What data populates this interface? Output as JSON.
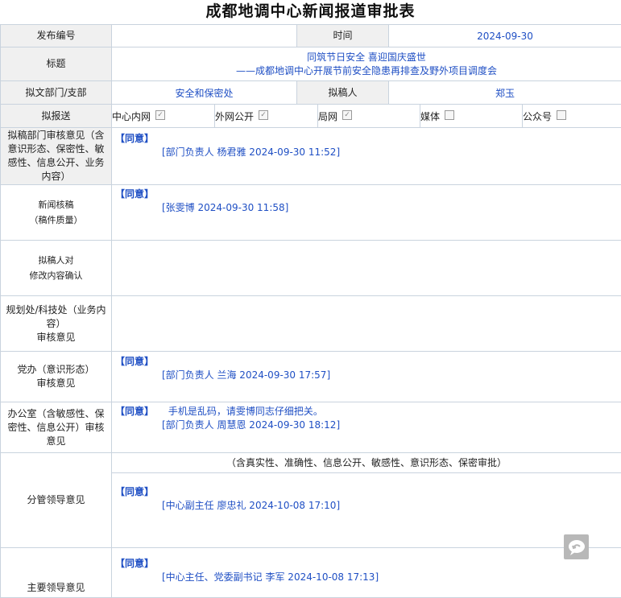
{
  "page_title": "成都地调中心新闻报道审批表",
  "rows": {
    "publish_no_label": "发布编号",
    "publish_no_value": "",
    "time_label": "时间",
    "time_value": "2024-09-30",
    "title_label": "标题",
    "title_line1": "同筑节日安全 喜迎国庆盛世",
    "title_line2": "——成都地调中心开展节前安全隐患再排查及野外项目调度会",
    "dept_label": "拟文部门/支部",
    "dept_value": "安全和保密处",
    "drafter_label": "拟稿人",
    "drafter_value": "郑玉",
    "send_label": "拟报送",
    "send_options": [
      {
        "label": "中心内网",
        "checked": true
      },
      {
        "label": "外网公开",
        "checked": true
      },
      {
        "label": "局网",
        "checked": true
      },
      {
        "label": "媒体",
        "checked": false
      },
      {
        "label": "公众号",
        "checked": false
      }
    ],
    "dept_review_label": "拟稿部门审核意见（含意识形态、保密性、敏感性、信息公开、业务内容）",
    "dept_review_agree": "【同意】",
    "dept_review_sign": "[部门负责人 杨君雅 2024-09-30 11:52]",
    "news_check_label1": "新闻核稿",
    "news_check_label2": "（稿件质量）",
    "news_check_agree": "【同意】",
    "news_check_sign": "[张雯博 2024-09-30 11:58]",
    "confirm_label1": "拟稿人对",
    "confirm_label2": "修改内容确认",
    "planning_label1": "规划处/科技处（业务内容）",
    "planning_label2": "审核意见",
    "party_label1": "党办（意识形态）",
    "party_label2": "审核意见",
    "party_agree": "【同意】",
    "party_sign": "[部门负责人 兰海 2024-09-30 17:57]",
    "office_label": "办公室（含敏感性、保密性、信息公开）审核意见",
    "office_agree": "【同意】",
    "office_comment": "手机是乱码，请雯博同志仔细把关。",
    "office_sign": "[部门负责人 周慧恩 2024-09-30 18:12]",
    "leader_label": "分管领导意见",
    "leader_note": "（含真实性、准确性、信息公开、敏感性、意识形态、保密审批）",
    "leader_agree": "【同意】",
    "leader_sign": "[中心副主任 廖忠礼 2024-10-08 17:10]",
    "main_leader_label": "主要领导意见",
    "main_leader_agree": "【同意】",
    "main_leader_sign": "[中心主任、党委副书记 李军 2024-10-08 17:13]"
  },
  "icons": {
    "floating": "chat-return-icon"
  }
}
